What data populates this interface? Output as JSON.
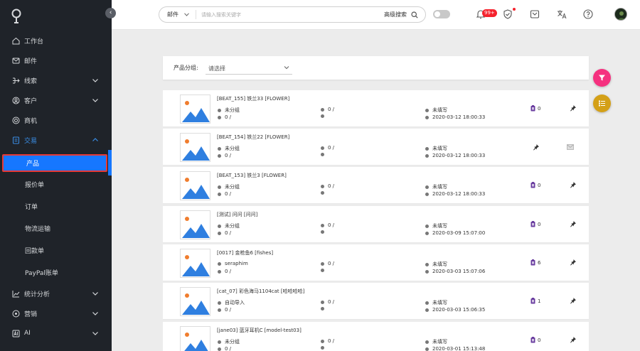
{
  "sidebar": {
    "top_items": [
      {
        "label": "工作台",
        "icon": "home-icon",
        "has_chevron": false
      },
      {
        "label": "邮件",
        "icon": "mail-icon",
        "has_chevron": false
      },
      {
        "label": "线索",
        "icon": "leads-icon",
        "has_chevron": true
      },
      {
        "label": "客户",
        "icon": "customer-icon",
        "has_chevron": true
      },
      {
        "label": "商机",
        "icon": "opportunity-icon",
        "has_chevron": false
      },
      {
        "label": "交易",
        "icon": "deal-icon",
        "has_chevron": true,
        "expanded": true
      }
    ],
    "sub_items": [
      {
        "label": "产品",
        "selected": true
      },
      {
        "label": "报价单"
      },
      {
        "label": "订单"
      },
      {
        "label": "物流运输"
      },
      {
        "label": "回款单"
      },
      {
        "label": "PayPal账单"
      }
    ],
    "bottom_items": [
      {
        "label": "统计分析",
        "icon": "chart-icon",
        "has_chevron": true
      },
      {
        "label": "营销",
        "icon": "marketing-icon",
        "has_chevron": true
      },
      {
        "label": "AI",
        "icon": "ai-icon",
        "has_chevron": true
      }
    ]
  },
  "topbar": {
    "search_category": "邮件",
    "search_placeholder": "请输入搜索关键字",
    "advanced_search": "高级搜索",
    "notification_badge": "99+"
  },
  "filter": {
    "label": "产品分组:",
    "placeholder": "请选择"
  },
  "products": [
    {
      "title": "[BEAT_155]   铁兰33   [FLOWER]",
      "group": "未分组",
      "qty": "0 /",
      "stock": "0 /",
      "stock2": "",
      "filled": "未填写",
      "date": "2020-03-12 18:00:33",
      "count": "0",
      "icon_mode": "count"
    },
    {
      "title": "[BEAT_154]   铁兰22   [FLOWER]",
      "group": "未分组",
      "qty": "0 /",
      "stock": "0 /",
      "stock2": "",
      "filled": "未填写",
      "date": "2020-03-12 18:00:33",
      "count": "",
      "icon_mode": "pin-mail"
    },
    {
      "title": "[BEAT_153]   铁兰3   [FLOWER]",
      "group": "未分组",
      "qty": "0 /",
      "stock": "0 /",
      "stock2": "",
      "filled": "未填写",
      "date": "2020-03-12 18:00:33",
      "count": "0",
      "icon_mode": "count"
    },
    {
      "title": "[测试]   问问   [问问]",
      "group": "未分组",
      "qty": "0 /",
      "stock": "0 /",
      "stock2": "",
      "filled": "未填写",
      "date": "2020-03-09 15:07:00",
      "count": "0",
      "icon_mode": "count"
    },
    {
      "title": "[0017]   金枪鱼6   [fishes]",
      "group": "seraphim",
      "qty": "0 /",
      "stock": "0 /",
      "stock2": "",
      "filled": "未填写",
      "date": "2020-03-03 15:07:06",
      "count": "6",
      "icon_mode": "count"
    },
    {
      "title": "[cat_07]   彩色海马1104cat   [哈哈哈哈]",
      "group": "自动导入",
      "qty": "0 /",
      "stock": "0 /",
      "stock2": "",
      "filled": "未填写",
      "date": "2020-03-03 15:06:35",
      "count": "1",
      "icon_mode": "count"
    },
    {
      "title": "[jane03]   蓝牙耳机C   [model-test03]",
      "group": "未分组",
      "qty": "0 /",
      "stock": "0 /",
      "stock2": "",
      "filled": "未填写",
      "date": "2020-03-01 15:13:48",
      "count": "0",
      "icon_mode": "count"
    }
  ],
  "colors": {
    "sidebar_bg": "#1f2329",
    "accent": "#1677ff",
    "fab_filter": "#f5317f",
    "fab_list": "#d4a017",
    "badge": "#f5222d"
  }
}
